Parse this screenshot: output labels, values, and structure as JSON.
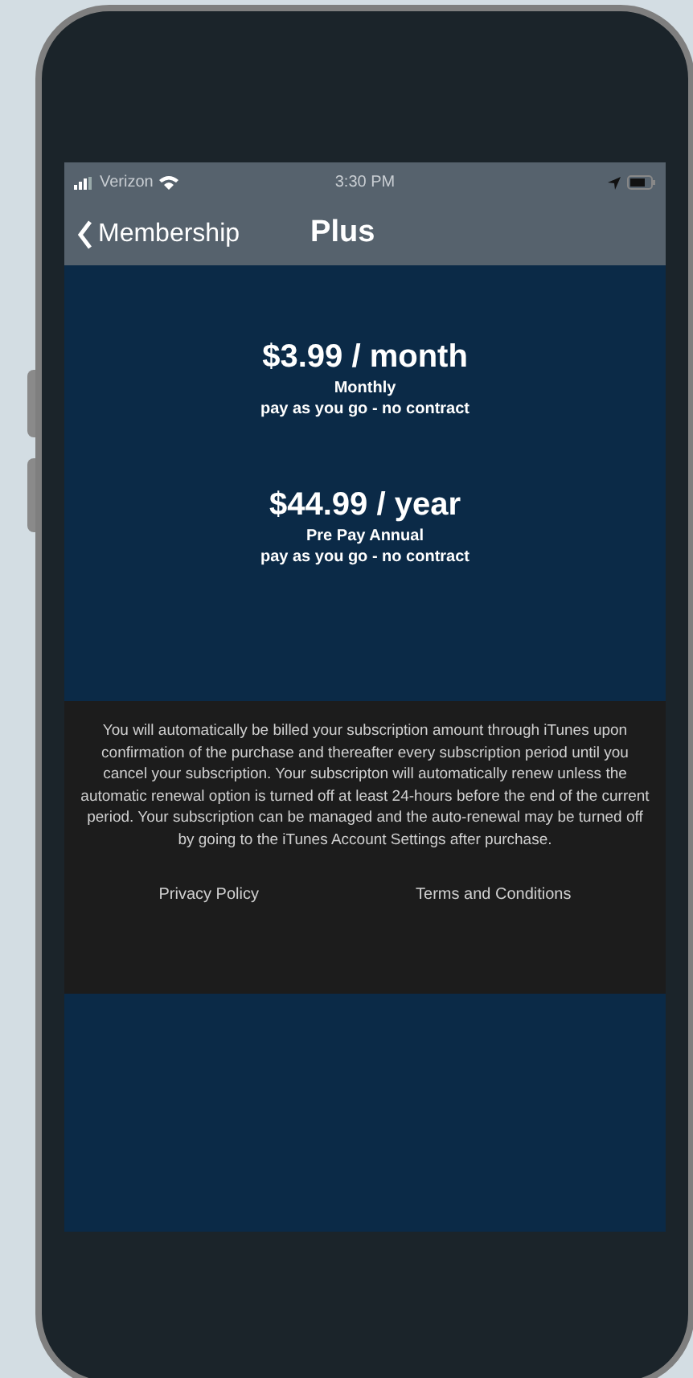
{
  "status_bar": {
    "carrier": "Verizon",
    "time": "3:30 PM"
  },
  "nav": {
    "back_label": "Membership",
    "title": "Plus"
  },
  "plans": [
    {
      "price": "$3.99 / month",
      "name": "Monthly",
      "terms": "pay as you go - no contract"
    },
    {
      "price": "$44.99 / year",
      "name": "Pre Pay Annual",
      "terms": "pay as you go - no contract"
    }
  ],
  "legal": {
    "text": "You will automatically be billed your subscription amount through iTunes upon confirmation of the purchase and thereafter every subscription period until you cancel your subscription.  Your subscripton will automatically renew unless the automatic renewal option is turned off at least 24-hours before the end of the current period.  Your subscription can be managed and the auto-renewal may be turned off by going to the iTunes Account Settings after purchase.",
    "links": [
      "Privacy Policy",
      "Terms and Conditions"
    ]
  }
}
